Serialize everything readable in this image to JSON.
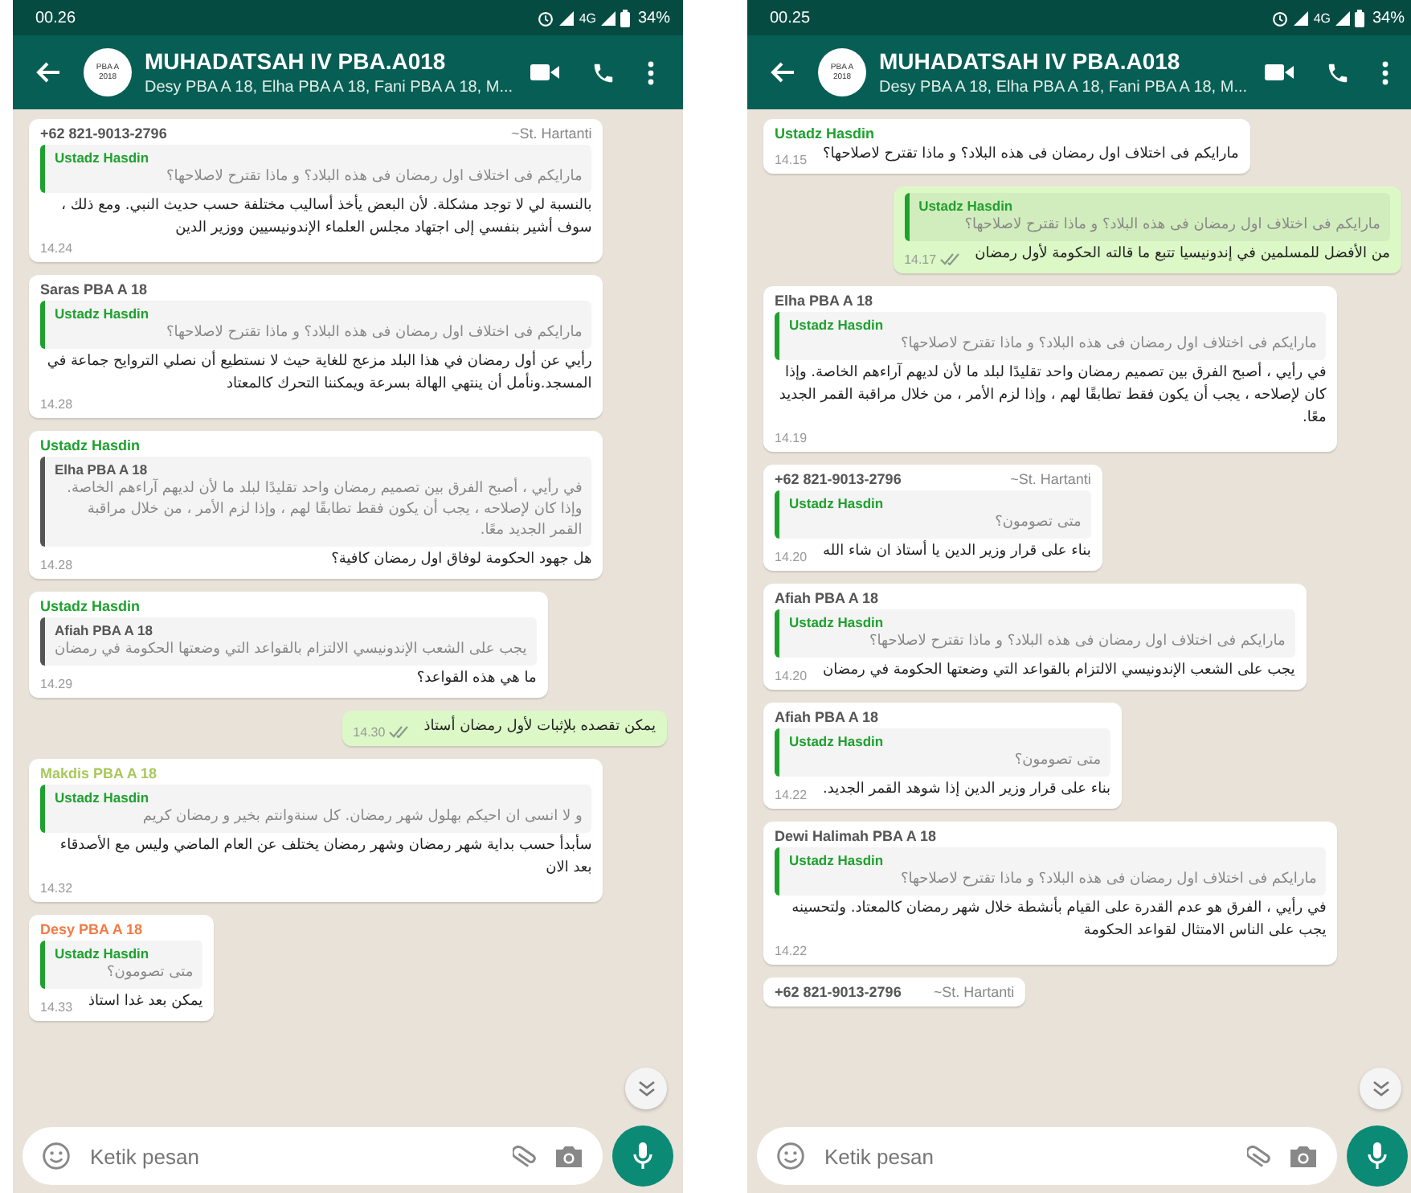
{
  "left_screen": {
    "status_bar": {
      "time": "00.26",
      "network": "4G",
      "battery": "34%"
    },
    "header": {
      "avatar_lines": [
        "PBA A",
        "2018"
      ],
      "title": "MUHADATSAH IV PBA.A018",
      "subtitle": "Desy PBA A 18, Elha PBA A 18, Fani PBA A 18, M..."
    },
    "messages": [
      {
        "kind": "incoming",
        "sender": "+62 821-9013-2796",
        "color": "#555555",
        "alias": "~St. Hartanti",
        "quote": {
          "author": "Ustadz Hasdin",
          "color": "#1fa12f",
          "text": "مارايكم فى اختلاف اول رمضان فى هذه البلاد؟ و ماذا تقترح لاصلاحها؟"
        },
        "text": "بالنسبة لي لا توجد مشكلة. لأن البعض يأخذ أساليب مختلفة حسب حديث النبي. ومع ذلك ، سوف أشير بنفسي إلى اجتهاد مجلس العلماء الإندونيسيين ووزير الدين",
        "time": "14.24"
      },
      {
        "kind": "incoming",
        "sender": "Saras PBA A 18",
        "color": "#555555",
        "quote": {
          "author": "Ustadz Hasdin",
          "color": "#1fa12f",
          "text": "مارايكم فى اختلاف اول رمضان فى هذه البلاد؟ و ماذا تقترح لاصلاحها؟"
        },
        "text": "رأيي عن أول رمضان في هذا البلد مزعج للغاية حيث لا نستطيع أن نصلي التروايح جماعة في المسجد.ونأمل أن ينتهي الهالة بسرعة ويمكننا التحرك كالمعتاد",
        "time": "14.28"
      },
      {
        "kind": "incoming",
        "sender": "Ustadz Hasdin",
        "color": "#1fa12f",
        "quote": {
          "author": "Elha PBA A 18",
          "color": "#555555",
          "text": "في رأيي ، أصبح الفرق بين تصميم رمضان واحد تقليدًا لبلد ما لأن لديهم آراءهم الخاصة. وإذا كان لإصلاحه ، يجب أن يكون فقط تطابقًا لهم ، وإذا لزم الأمر ، من خلال مراقبة القمر الجديد معًا."
        },
        "text": "هل جهود الحكومة لوفاق اول رمضان كافية؟",
        "time": "14.28"
      },
      {
        "kind": "incoming",
        "sender": "Ustadz Hasdin",
        "color": "#1fa12f",
        "quote": {
          "author": "Afiah PBA A 18",
          "color": "#555555",
          "text": "يجب على الشعب الإندونيسي الالتزام بالقواعد التي وضعتها الحكومة في رمضان"
        },
        "text": "ما هي هذه القواعد؟",
        "time": "14.29"
      },
      {
        "kind": "outgoing",
        "text": "يمكن تقصده بلإثبات لأول رمضان أستاذ",
        "time": "14.30"
      },
      {
        "kind": "incoming",
        "sender": "Makdis PBA A 18",
        "color": "#a9c85c",
        "quote": {
          "author": "Ustadz Hasdin",
          "color": "#1fa12f",
          "text": "و لا انسى ان احيكم بهلول شهر رمضان. كل سنةوانتم بخير و رمضان كريم"
        },
        "text": "سأبدأ حسب بداية شهر رمضان وشهر رمضان يختلف عن العام الماضي وليس مع الأصدقاء بعد الان",
        "time": "14.32"
      },
      {
        "kind": "incoming",
        "sender": "Desy PBA A 18",
        "color": "#f27c45",
        "quote": {
          "author": "Ustadz Hasdin",
          "color": "#1fa12f",
          "text": "متى تصومون؟"
        },
        "text": "يمكن بعد غدا استاذ",
        "time": "14.33"
      }
    ],
    "composer": {
      "placeholder": "Ketik pesan"
    }
  },
  "right_screen": {
    "status_bar": {
      "time": "00.25",
      "network": "4G",
      "battery": "34%"
    },
    "header": {
      "avatar_lines": [
        "PBA A",
        "2018"
      ],
      "title": "MUHADATSAH IV PBA.A018",
      "subtitle": "Desy PBA A 18, Elha PBA A 18, Fani PBA A 18, M..."
    },
    "messages": [
      {
        "kind": "incoming",
        "sender": "Ustadz Hasdin",
        "color": "#1fa12f",
        "text": "مارايكم فى اختلاف اول رمضان فى هذه البلاد؟ و ماذا تقترح لاصلاحها؟",
        "time": "14.15"
      },
      {
        "kind": "outgoing",
        "quote": {
          "author": "Ustadz Hasdin",
          "color": "#1fa12f",
          "text": "مارايكم فى اختلاف اول رمضان فى هذه البلاد؟ و ماذا تقترح لاصلاحها؟"
        },
        "text": "من الأفضل للمسلمين في إندونيسيا تتبع ما قالته الحكومة لأول رمضان",
        "time": "14.17"
      },
      {
        "kind": "incoming",
        "sender": "Elha PBA A 18",
        "color": "#555555",
        "quote": {
          "author": "Ustadz Hasdin",
          "color": "#1fa12f",
          "text": "مارايكم فى اختلاف اول رمضان فى هذه البلاد؟ و ماذا تقترح لاصلاحها؟"
        },
        "text": "في رأيي ، أصبح الفرق بين تصميم رمضان واحد تقليدًا لبلد ما لأن لديهم آراءهم الخاصة. وإذا كان لإصلاحه ، يجب أن يكون فقط تطابقًا لهم ، وإذا لزم الأمر ، من خلال مراقبة القمر الجديد معًا.",
        "time": "14.19"
      },
      {
        "kind": "incoming",
        "sender": "+62 821-9013-2796",
        "color": "#555555",
        "alias": "~St. Hartanti",
        "quote": {
          "author": "Ustadz Hasdin",
          "color": "#1fa12f",
          "text": "متى تصومون؟"
        },
        "text": "بناء على قرار وزير الدين يا أستاذ ان شاء الله",
        "time": "14.20"
      },
      {
        "kind": "incoming",
        "sender": "Afiah PBA A 18",
        "color": "#555555",
        "quote": {
          "author": "Ustadz Hasdin",
          "color": "#1fa12f",
          "text": "مارايكم فى اختلاف اول رمضان فى هذه البلاد؟ و ماذا تقترح لاصلاحها؟"
        },
        "text": "يجب على الشعب الإندونيسي الالتزام بالقواعد التي وضعتها الحكومة في رمضان",
        "time": "14.20"
      },
      {
        "kind": "incoming",
        "sender": "Afiah PBA A 18",
        "color": "#555555",
        "quote": {
          "author": "Ustadz Hasdin",
          "color": "#1fa12f",
          "text": "متى تصومون؟"
        },
        "text": "بناء على قرار وزير الدين إذا شوهد القمر الجديد.",
        "time": "14.22"
      },
      {
        "kind": "incoming",
        "sender": "Dewi Halimah PBA A 18",
        "color": "#555555",
        "quote": {
          "author": "Ustadz Hasdin",
          "color": "#1fa12f",
          "text": "مارايكم فى اختلاف اول رمضان فى هذه البلاد؟ و ماذا تقترح لاصلاحها؟"
        },
        "text": "في رأيي ، الفرق هو عدم القدرة على القيام بأنشطة خلال شهر رمضان كالمعتاد. ولتحسينه يجب على الناس الامتثال لقواعد الحكومة",
        "time": "14.22"
      },
      {
        "kind": "incoming",
        "sender": "+62 821-9013-2796",
        "color": "#555555",
        "alias": "~St. Hartanti"
      }
    ],
    "composer": {
      "placeholder": "Ketik pesan"
    }
  }
}
